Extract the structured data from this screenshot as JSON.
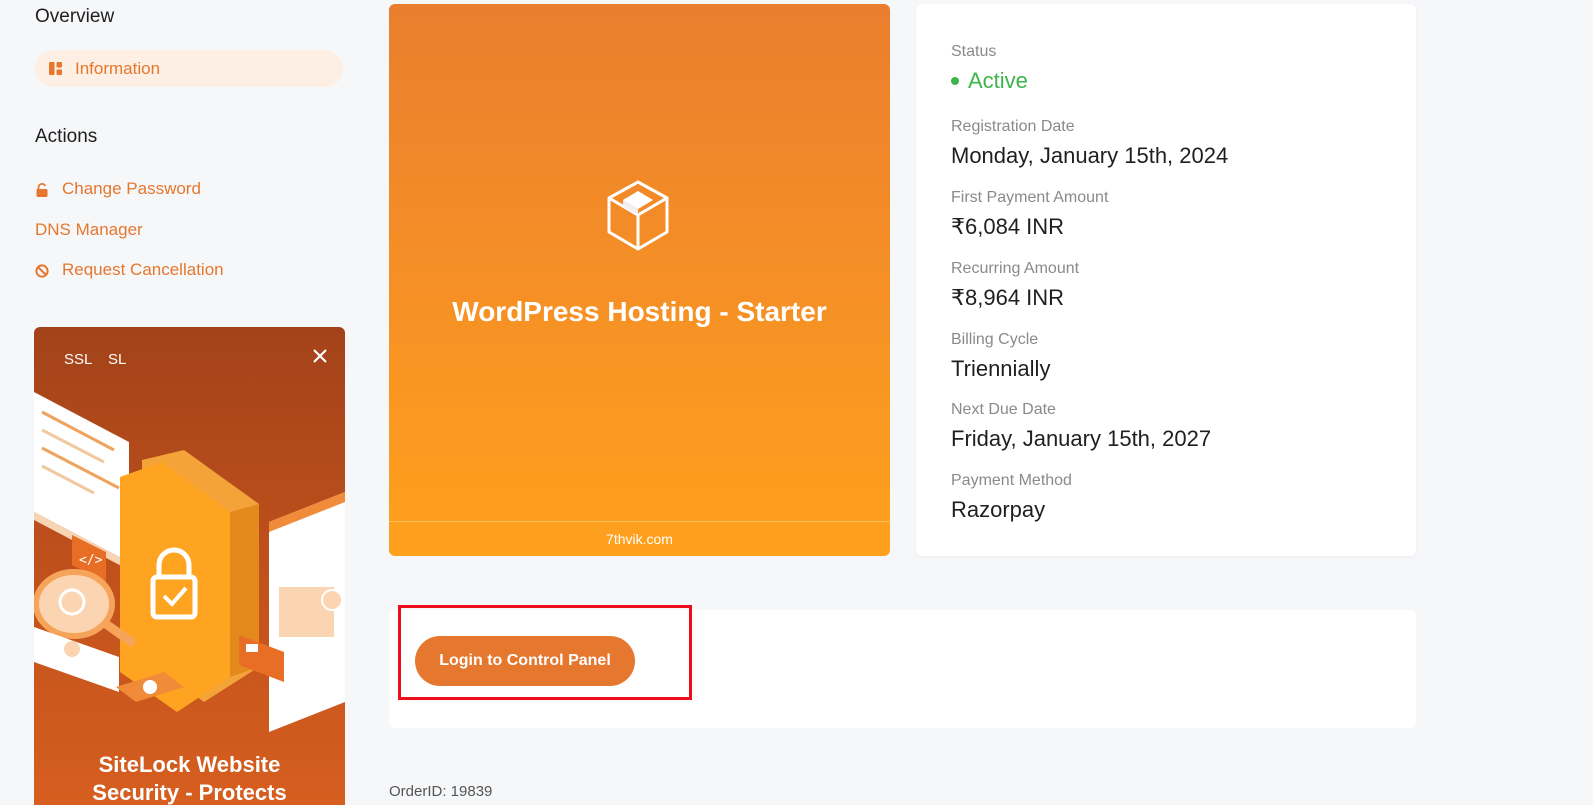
{
  "sidebar": {
    "overview_title": "Overview",
    "information_label": "Information",
    "actions_title": "Actions",
    "actions": {
      "change_password": "Change Password",
      "dns_manager": "DNS Manager",
      "request_cancellation": "Request Cancellation"
    }
  },
  "promo": {
    "tag1": "SSL",
    "tag2": "SL",
    "headline_line1": "SiteLock Website",
    "headline_line2": "Security - Protects"
  },
  "product": {
    "name": "WordPress Hosting - Starter",
    "domain": "7thvik.com"
  },
  "details": {
    "status_label": "Status",
    "status_value": "Active",
    "registration_label": "Registration Date",
    "registration_value": "Monday, January 15th, 2024",
    "first_payment_label": "First Payment Amount",
    "first_payment_value": "₹6,084 INR",
    "recurring_label": "Recurring Amount",
    "recurring_value": "₹8,964 INR",
    "billing_cycle_label": "Billing Cycle",
    "billing_cycle_value": "Triennially",
    "next_due_label": "Next Due Date",
    "next_due_value": "Friday, January 15th, 2027",
    "payment_method_label": "Payment Method",
    "payment_method_value": "Razorpay"
  },
  "login_panel": {
    "button_label": "Login to Control Panel"
  },
  "order_id": "OrderID: 19839",
  "colors": {
    "accent": "#e6772e",
    "active_green": "#3cb54a",
    "highlight_red": "#ee0e1a"
  },
  "icons": {
    "information": "dashboard-icon",
    "change_password": "lock-icon",
    "request_cancellation": "ban-icon",
    "promo_close": "close-icon",
    "product": "cube-icon"
  }
}
